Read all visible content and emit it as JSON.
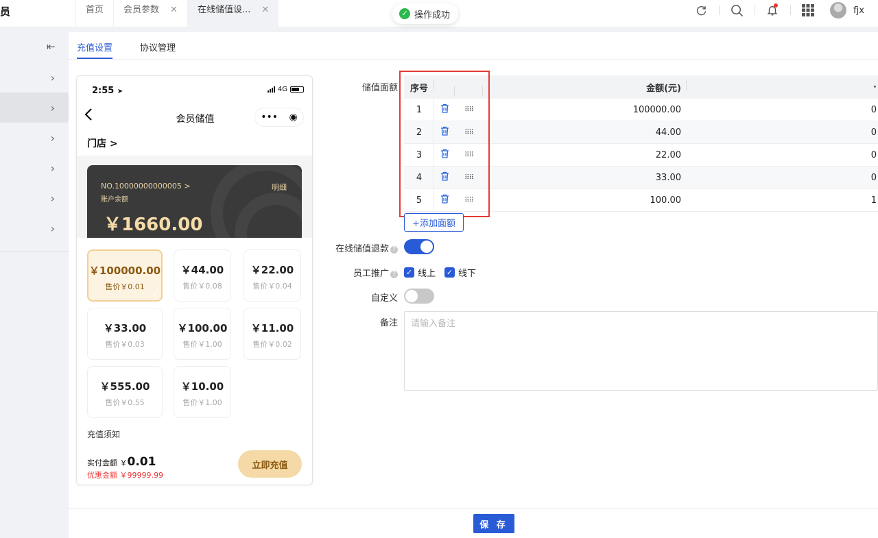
{
  "brand": "员",
  "tabs": [
    {
      "label": "首页"
    },
    {
      "label": "会员参数"
    },
    {
      "label": "在线储值设..."
    }
  ],
  "toast": {
    "text": "操作成功"
  },
  "user": {
    "name": "fjx"
  },
  "subtabs": [
    {
      "label": "充值设置"
    },
    {
      "label": "协议管理"
    }
  ],
  "phone": {
    "time": "2:55",
    "network": "4G",
    "title": "会员储值",
    "capsule_more": "•••",
    "capsule_target": "◉",
    "store": "门店 >",
    "card_no": "NO.10000000000005 >",
    "balance_label": "账户余额",
    "detail": "明细",
    "balance": "￥1660.00",
    "options": [
      {
        "price": "￥100000.00",
        "sale": "售价￥0.01"
      },
      {
        "price": "￥44.00",
        "sale": "售价￥0.08"
      },
      {
        "price": "￥22.00",
        "sale": "售价￥0.04"
      },
      {
        "price": "￥33.00",
        "sale": "售价￥0.03"
      },
      {
        "price": "￥100.00",
        "sale": "售价￥1.00"
      },
      {
        "price": "￥11.00",
        "sale": "售价￥0.02"
      },
      {
        "price": "￥555.00",
        "sale": "售价￥0.55"
      },
      {
        "price": "￥10.00",
        "sale": "售价￥1.00"
      }
    ],
    "notice": "充值须知",
    "pay_label": "实付金额",
    "pay_currency": "￥",
    "pay_value": "0.01",
    "discount": "优惠金额 ￥99999.99",
    "pay_button": "立即充值"
  },
  "form": {
    "amount_label": "储值面额",
    "columns": {
      "seq": "序号",
      "amount": "金额(元)"
    },
    "rows": [
      {
        "seq": "1",
        "amount": "100000.00"
      },
      {
        "seq": "2",
        "amount": "44.00"
      },
      {
        "seq": "3",
        "amount": "22.00"
      },
      {
        "seq": "4",
        "amount": "33.00"
      },
      {
        "seq": "5",
        "amount": "100.00"
      }
    ],
    "add_button": "+添加面额",
    "refund_label": "在线储值退款",
    "refund_on": true,
    "promo_label": "员工推广",
    "promo_online": "线上",
    "promo_offline": "线下",
    "custom_label": "自定义",
    "custom_on": false,
    "remark_label": "备注",
    "remark_placeholder": "请输入备注",
    "save_button": "保 存"
  },
  "colors": {
    "primary": "#2a5bd7",
    "highlight": "#e53a36",
    "gold": "#f5d9a6"
  }
}
